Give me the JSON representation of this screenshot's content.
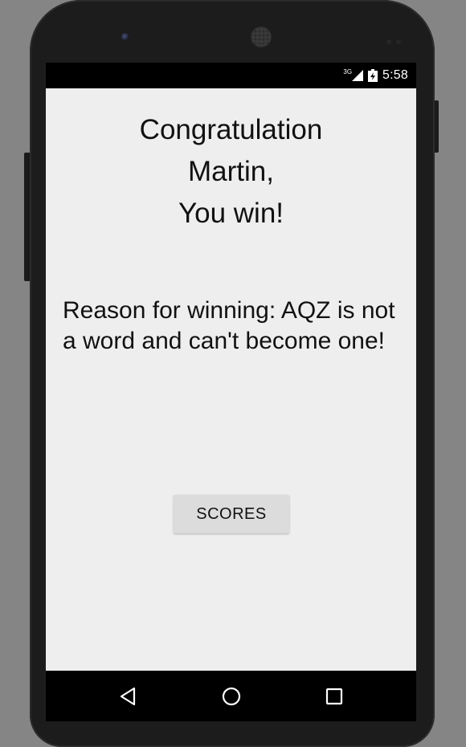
{
  "status_bar": {
    "network_type": "3G",
    "time": "5:58",
    "icons": [
      "signal-icon",
      "battery-icon"
    ]
  },
  "main": {
    "title_lines": [
      "Congratulation",
      "Martin,",
      "You win!"
    ],
    "reason_text": "Reason for winning: AQZ is not a word and can't become one!",
    "scores_button_label": "SCORES"
  },
  "nav_bar": {
    "icons": [
      "back-icon",
      "home-icon",
      "recent-apps-icon"
    ]
  },
  "colors": {
    "screen_background": "#eeeeee",
    "button_background": "#dcdcdc",
    "text": "#111111",
    "bars": "#000000",
    "device_body": "#1c1c1c",
    "backdrop": "#858585"
  }
}
